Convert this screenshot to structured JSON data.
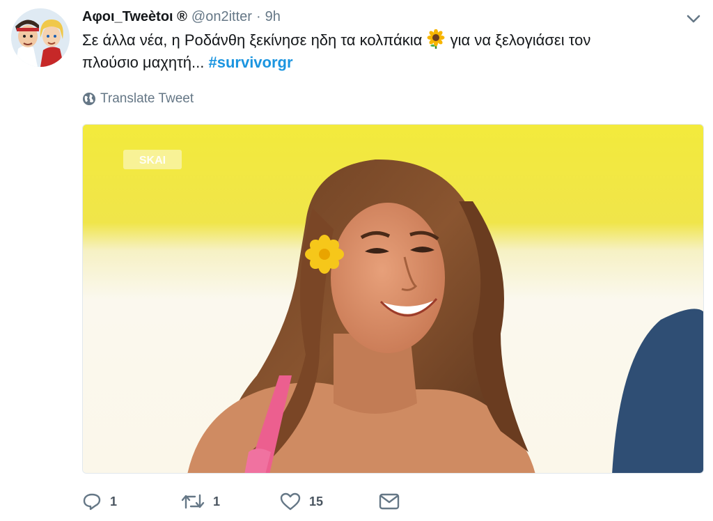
{
  "tweet": {
    "display_name": "Αφοι_Tweètoι ®",
    "handle": "@on2itter",
    "separator": "·",
    "time": "9h",
    "text_line1": "Σε άλλα νέα, η Ροδάνθη ξεκίνησε ηδη τα κολπάκια",
    "text_line1b": "για να ξελογιάσει τον",
    "text_line2": "πλούσιο μαχητή... ",
    "hashtag": "#survivorgr",
    "emoji": "sunflower",
    "translate_label": "Translate Tweet"
  },
  "icons": {
    "globe": "globe-icon",
    "caret": "chevron-down-icon",
    "reply": "reply-icon",
    "retweet": "retweet-icon",
    "like": "heart-icon",
    "dm": "envelope-icon"
  },
  "media": {
    "watermark": "SKAI"
  },
  "actions": {
    "reply_count": "1",
    "retweet_count": "1",
    "like_count": "15"
  },
  "colors": {
    "hashtag": "#1b95e0",
    "secondary_text": "#657786",
    "primary_text": "#14171a"
  }
}
